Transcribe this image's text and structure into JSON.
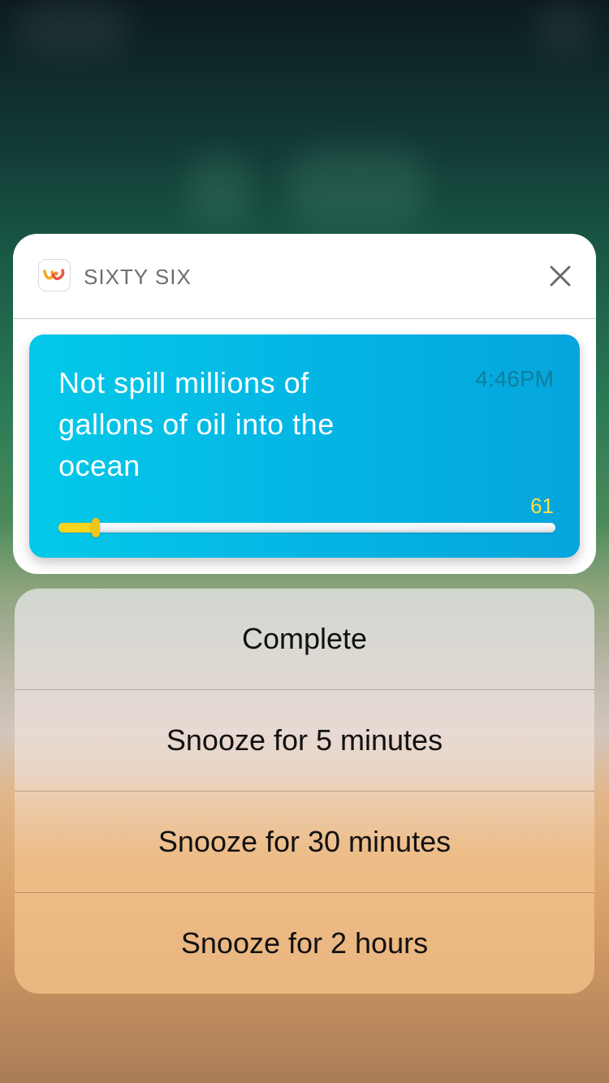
{
  "notification": {
    "app_name": "SIXTY SIX",
    "app_icon": "sixty-six-logo",
    "close_icon": "close-x-icon"
  },
  "habit": {
    "title": "Not spill millions of gallons of oil into the ocean",
    "time": "4:46PM",
    "progress_count": "61",
    "progress_fraction": 0.075
  },
  "actions": [
    {
      "label": "Complete"
    },
    {
      "label": "Snooze for 5 minutes"
    },
    {
      "label": "Snooze for 30 minutes"
    },
    {
      "label": "Snooze for 2 hours"
    }
  ],
  "colors": {
    "card_cyan": "#03c9e8",
    "card_blue": "#05a5dd",
    "progress_yellow": "#f6d31e",
    "count_yellow": "#f4e04d"
  }
}
